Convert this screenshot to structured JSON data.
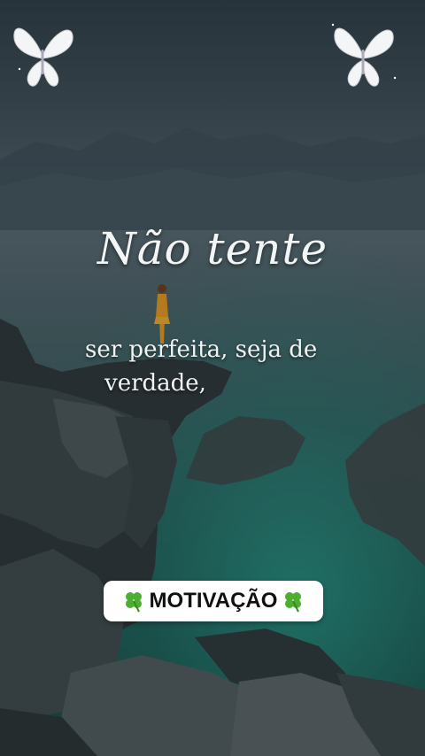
{
  "title": "Não tente",
  "subtitle_line1": "ser perfeita, seja de",
  "subtitle_line2": "verdade,",
  "badge": {
    "label": "MOTIVAÇÃO",
    "left_icon": "four-leaf-clover-icon",
    "right_icon": "four-leaf-clover-icon"
  },
  "decorations": {
    "top_left": "butterfly-icon",
    "top_right": "butterfly-icon"
  },
  "colors": {
    "text": "#f0f2f3",
    "badge_bg": "#ffffff",
    "badge_text": "#111111",
    "clover": "#4caf2f",
    "sea": "#1f544d"
  }
}
